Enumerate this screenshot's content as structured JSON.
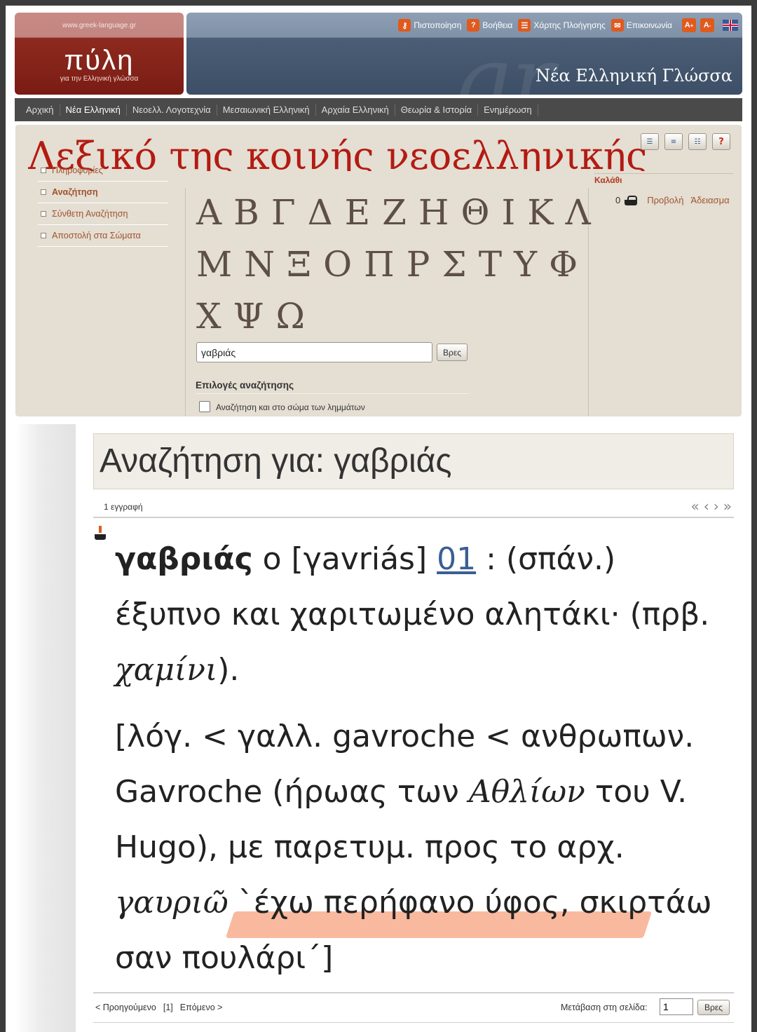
{
  "logo": {
    "url_text": "www.greek-language.gr",
    "title": "πύλη",
    "subtitle": "για την Ελληνική γλώσσα"
  },
  "banner": {
    "title": "Νέα Ελληνική Γλώσσα",
    "watermark": "gr"
  },
  "top_links": [
    {
      "label": "Πιστοποίηση",
      "icon": "key-icon"
    },
    {
      "label": "Βοήθεια",
      "icon": "help-icon"
    },
    {
      "label": "Χάρτης Πλοήγησης",
      "icon": "sitemap-icon"
    },
    {
      "label": "Επικοινωνία",
      "icon": "mail-icon"
    }
  ],
  "font_size": {
    "increase": "A",
    "decrease": "A"
  },
  "nav": {
    "items": [
      "Αρχική",
      "Νέα Ελληνική",
      "Νεοελλ. Λογοτεχνία",
      "Μεσαιωνική Ελληνική",
      "Αρχαία Ελληνική",
      "Θεωρία & Ιστορία",
      "Ενημέρωση"
    ],
    "active_index": 1
  },
  "dictionary": {
    "title": "Λεξικό της κοινής νεοελληνικής",
    "view_icons": [
      "list-view-icon",
      "detail-view-icon",
      "compact-view-icon",
      "help-icon"
    ],
    "help_label": "?",
    "menu": [
      "Πληροφορίες",
      "Αναζήτηση",
      "Σύνθετη Αναζήτηση",
      "Αποστολή στα Σώματα"
    ],
    "menu_active_index": 1,
    "alphabet_rows": [
      [
        "Α",
        "Β",
        "Γ",
        "Δ",
        "Ε",
        "Ζ",
        "Η",
        "Θ",
        "Ι",
        "Κ",
        "Λ"
      ],
      [
        "Μ",
        "Ν",
        "Ξ",
        "Ο",
        "Π",
        "Ρ",
        "Σ",
        "Τ",
        "Υ",
        "Φ"
      ],
      [
        "Χ",
        "Ψ",
        "Ω"
      ]
    ],
    "search_value": "γαβριάς",
    "search_button": "Βρες",
    "options_title": "Επιλογές αναζήτησης",
    "option_label": "Αναζήτηση και στο σώμα των λημμάτων",
    "option_checked": false
  },
  "basket": {
    "title": "Καλάθι",
    "count": "0",
    "view_label": "Προβολή",
    "empty_label": "Άδειασμα"
  },
  "results": {
    "heading": "Αναζήτηση για: γαβριάς",
    "count_text": "1 εγγραφή",
    "pager_symbols": [
      "«",
      "‹",
      "›",
      "»"
    ]
  },
  "entry": {
    "lemma": "γαβριάς",
    "article": " ο [γavriás] ",
    "ref": "01",
    "definition_rest": " : (σπάν.) έξυπνο και χαριτωμένο αλητάκι· (πρβ. ",
    "definition_italic": "χαμίνι",
    "definition_end": ").",
    "etym_1": "[λόγ. < γαλλ. gavroche < ανθρωπων. Gavroche (ήρωας των ",
    "etym_italic_1": "Αθλίων",
    "etym_2": " του V. Hugo), με παρετυμ. προς το αρχ. ",
    "etym_italic_2": "γαυριῶ",
    "etym_3": " `έχω περήφανο ύφος, σκιρτάω σαν πουλάρι΄]"
  },
  "pager_bottom": {
    "prev": "< Προηγούμενο",
    "current": "[1]",
    "next": "Επόμενο >",
    "goto_label": "Μετάβαση στη σελίδα:",
    "goto_value": "1",
    "goto_button": "Βρες"
  }
}
